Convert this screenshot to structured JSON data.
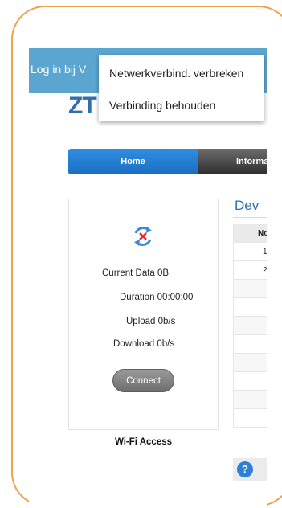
{
  "titlebar": {
    "title": "Log in bij V"
  },
  "logo": {
    "text": "ZT"
  },
  "menu": {
    "items": [
      {
        "label": "Netwerkverbind. verbreken"
      },
      {
        "label": "Verbinding behouden"
      }
    ]
  },
  "nav": {
    "tabs": [
      {
        "label": "Home"
      },
      {
        "label": "Informa"
      }
    ]
  },
  "status": {
    "current_data": "Current Data 0B",
    "duration": "Duration 00:00:00",
    "upload": "Upload 0b/s",
    "download": "Download 0b/s",
    "connect_label": "Connect",
    "wifi_label": "Wi-Fi Access"
  },
  "devices": {
    "title": "Dev",
    "header": "No",
    "rows": [
      "1",
      "2",
      "",
      "",
      "",
      "",
      "",
      "",
      "",
      ""
    ]
  },
  "help": {
    "label": "?"
  },
  "colors": {
    "titlebar": "#5ba6d1",
    "accent": "#2f7fd6",
    "frame": "#f0a050",
    "disconnected": "#e03030"
  },
  "icons": {
    "status": "disconnected-arrows-icon",
    "help": "help-icon"
  }
}
